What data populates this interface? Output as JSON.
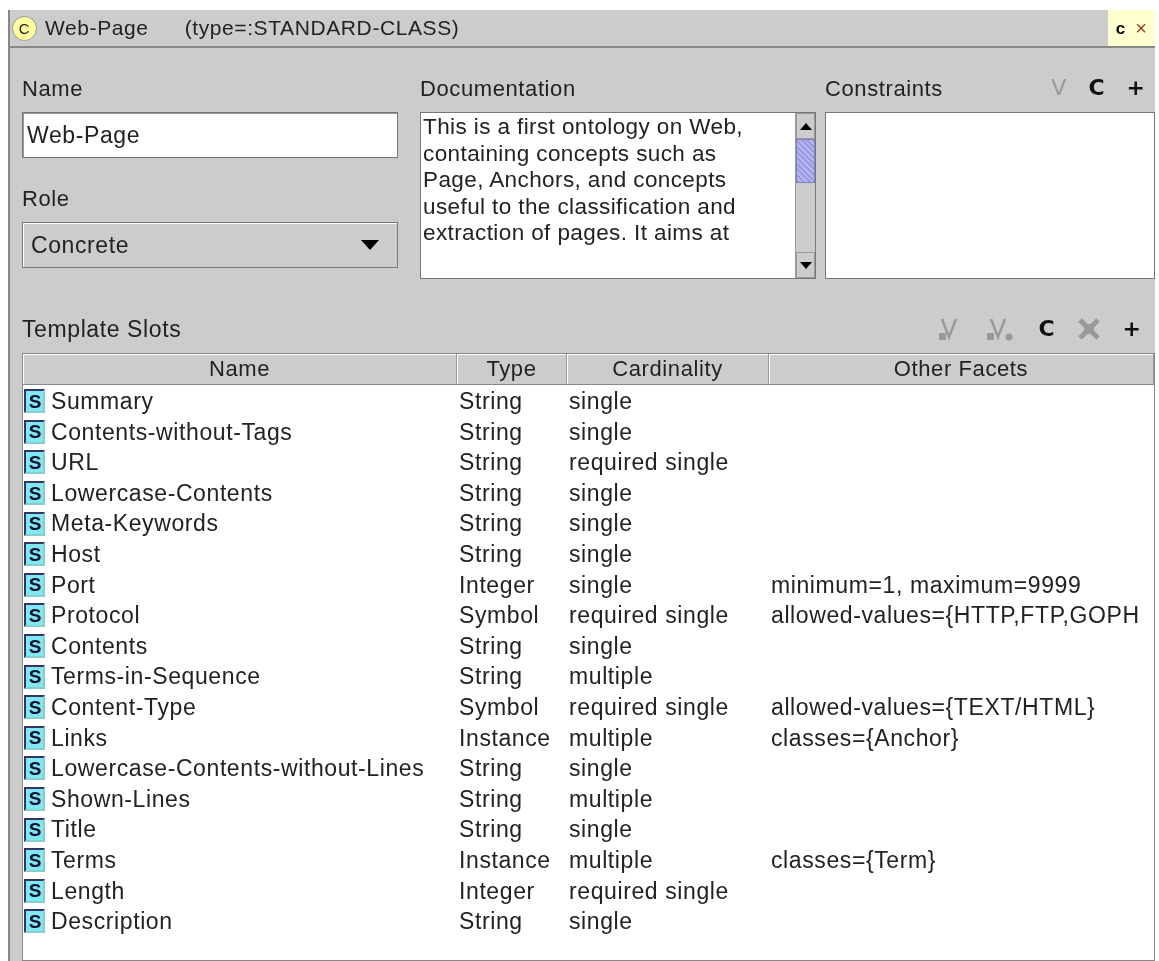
{
  "window": {
    "icon_letter": "C",
    "title": "Web-Page",
    "type_label": "(type=:STANDARD-CLASS)",
    "corner_buttons": [
      {
        "kind": "letter",
        "label": "c"
      },
      {
        "kind": "close",
        "label": "×"
      }
    ]
  },
  "name": {
    "label": "Name",
    "value": "Web-Page"
  },
  "role": {
    "label": "Role",
    "value": "Concrete"
  },
  "documentation": {
    "label": "Documentation",
    "lines": [
      "This is a first ontology on Web,",
      "containing concepts such as",
      "Page, Anchors, and concepts",
      "useful to the classification and",
      "extraction of pages. It aims at"
    ]
  },
  "constraints": {
    "label": "Constraints",
    "tools": [
      {
        "kind": "glyph",
        "label": "V",
        "disabled": true
      },
      {
        "kind": "glyph",
        "label": "C",
        "disabled": false
      },
      {
        "kind": "glyph",
        "label": "+",
        "disabled": false
      }
    ]
  },
  "template_slots": {
    "label": "Template Slots",
    "tools": [
      {
        "kind": "view-slot",
        "disabled": true
      },
      {
        "kind": "view-facet",
        "disabled": true
      },
      {
        "kind": "glyph",
        "label": "C",
        "disabled": false
      },
      {
        "kind": "remove",
        "disabled": true
      },
      {
        "kind": "glyph",
        "label": "+",
        "disabled": false
      }
    ],
    "columns": [
      "Name",
      "Type",
      "Cardinality",
      "Other Facets"
    ],
    "rows": [
      {
        "icon_letter": "S",
        "name": "Summary",
        "type": "String",
        "cardinality": "single",
        "other": ""
      },
      {
        "icon_letter": "S",
        "name": "Contents-without-Tags",
        "type": "String",
        "cardinality": "single",
        "other": ""
      },
      {
        "icon_letter": "S",
        "name": "URL",
        "type": "String",
        "cardinality": "required single",
        "other": ""
      },
      {
        "icon_letter": "S",
        "name": "Lowercase-Contents",
        "type": "String",
        "cardinality": "single",
        "other": ""
      },
      {
        "icon_letter": "S",
        "name": "Meta-Keywords",
        "type": "String",
        "cardinality": "single",
        "other": ""
      },
      {
        "icon_letter": "S",
        "name": "Host",
        "type": "String",
        "cardinality": "single",
        "other": ""
      },
      {
        "icon_letter": "S",
        "name": "Port",
        "type": "Integer",
        "cardinality": "single",
        "other": "minimum=1, maximum=9999"
      },
      {
        "icon_letter": "S",
        "name": "Protocol",
        "type": "Symbol",
        "cardinality": "required single",
        "other": "allowed-values={HTTP,FTP,GOPH"
      },
      {
        "icon_letter": "S",
        "name": "Contents",
        "type": "String",
        "cardinality": "single",
        "other": ""
      },
      {
        "icon_letter": "S",
        "name": "Terms-in-Sequence",
        "type": "String",
        "cardinality": "multiple",
        "other": ""
      },
      {
        "icon_letter": "S",
        "name": "Content-Type",
        "type": "Symbol",
        "cardinality": "required single",
        "other": "allowed-values={TEXT/HTML}"
      },
      {
        "icon_letter": "S",
        "name": "Links",
        "type": "Instance",
        "cardinality": "multiple",
        "other": "classes={Anchor}"
      },
      {
        "icon_letter": "S",
        "name": "Lowercase-Contents-without-Lines",
        "type": "String",
        "cardinality": "single",
        "other": ""
      },
      {
        "icon_letter": "S",
        "name": "Shown-Lines",
        "type": "String",
        "cardinality": "multiple",
        "other": ""
      },
      {
        "icon_letter": "S",
        "name": "Title",
        "type": "String",
        "cardinality": "single",
        "other": ""
      },
      {
        "icon_letter": "S",
        "name": "Terms",
        "type": "Instance",
        "cardinality": "multiple",
        "other": "classes={Term}"
      },
      {
        "icon_letter": "S",
        "name": "Length",
        "type": "Integer",
        "cardinality": "required single",
        "other": ""
      },
      {
        "icon_letter": "S",
        "name": "Description",
        "type": "String",
        "cardinality": "single",
        "other": ""
      }
    ]
  }
}
